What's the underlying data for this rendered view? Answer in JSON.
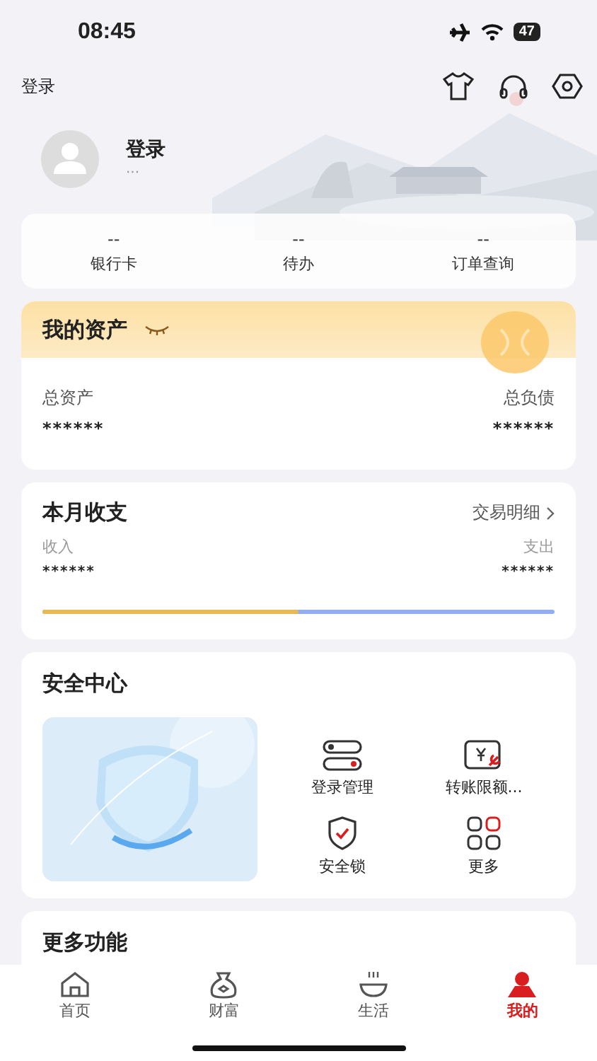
{
  "status_bar": {
    "time": "08:45",
    "battery": "47"
  },
  "header": {
    "login_link": "登录"
  },
  "profile": {
    "name": "登录",
    "subtitle": "···"
  },
  "stats": [
    {
      "value": "--",
      "label": "银行卡"
    },
    {
      "value": "--",
      "label": "待办"
    },
    {
      "value": "--",
      "label": "订单查询"
    }
  ],
  "assets": {
    "title": "我的资产",
    "left_label": "总资产",
    "left_value": "******",
    "right_label": "总负债",
    "right_value": "******"
  },
  "monthly": {
    "title": "本月收支",
    "link": "交易明细",
    "income_label": "收入",
    "income_value": "******",
    "expense_label": "支出",
    "expense_value": "******",
    "level": 0.5
  },
  "security": {
    "title": "安全中心",
    "items": [
      {
        "kind": "toggles",
        "label": "登录管理"
      },
      {
        "kind": "limit",
        "label": "转账限额..."
      },
      {
        "kind": "shield",
        "label": "安全锁"
      },
      {
        "kind": "grid",
        "label": "更多"
      }
    ]
  },
  "more": {
    "title": "更多功能"
  },
  "tabs": [
    {
      "kind": "home",
      "label": "首页",
      "selected": false
    },
    {
      "kind": "wealth",
      "label": "财富",
      "selected": false
    },
    {
      "kind": "life",
      "label": "生活",
      "selected": false
    },
    {
      "kind": "me",
      "label": "我的",
      "selected": true
    }
  ]
}
